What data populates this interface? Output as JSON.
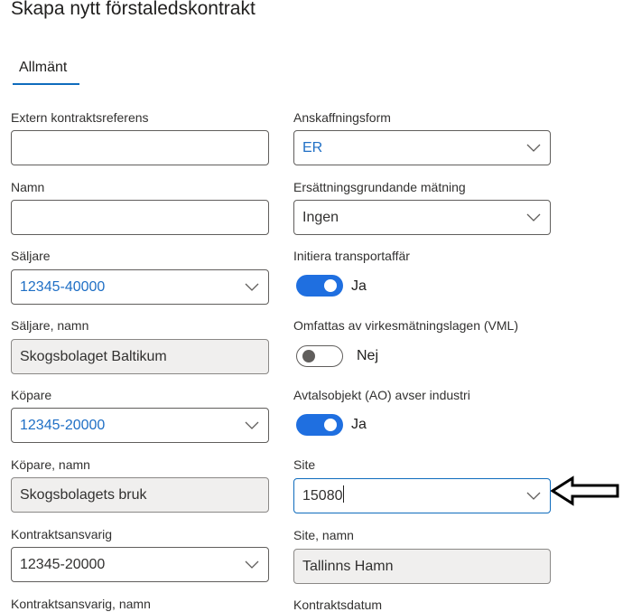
{
  "page": {
    "title": "Skapa nytt förstaledskontrakt"
  },
  "tabs": [
    {
      "label": "Allmänt"
    }
  ],
  "fields": {
    "extern_ref": {
      "label": "Extern kontraktsreferens",
      "value": ""
    },
    "anskaffningsform": {
      "label": "Anskaffningsform",
      "value": "ER"
    },
    "namn": {
      "label": "Namn",
      "value": ""
    },
    "ersattning": {
      "label": "Ersättningsgrundande mätning",
      "value": "Ingen"
    },
    "saljare": {
      "label": "Säljare",
      "value": "12345-40000"
    },
    "initiera": {
      "label": "Initiera transportaffär",
      "state": "Ja",
      "on": true
    },
    "saljare_namn": {
      "label": "Säljare, namn",
      "value": "Skogsbolaget Baltikum"
    },
    "vml": {
      "label": "Omfattas av virkesmätningslagen (VML)",
      "state": "Nej",
      "on": false
    },
    "kopare": {
      "label": "Köpare",
      "value": "12345-20000"
    },
    "avtalsobjekt": {
      "label": "Avtalsobjekt (AO) avser industri",
      "state": "Ja",
      "on": true
    },
    "kopare_namn": {
      "label": "Köpare, namn",
      "value": "Skogsbolagets bruk"
    },
    "site": {
      "label": "Site",
      "value": "15080"
    },
    "kontraktsansvarig": {
      "label": "Kontraktsansvarig",
      "value": "12345-20000"
    },
    "site_namn": {
      "label": "Site, namn",
      "value": "Tallinns Hamn"
    },
    "kontraktsansvarig_namn": {
      "label": "Kontraktsansvarig, namn"
    },
    "kontraktsdatum": {
      "label": "Kontraktsdatum"
    }
  },
  "colors": {
    "accent": "#0f6cbd",
    "link_value": "#1f6fc5",
    "toggle_on": "#1f6fe0",
    "readonly_bg": "#f0efee"
  },
  "icons": {
    "dropdown": "chevron-down-icon",
    "annotation": "arrow-left-icon"
  }
}
